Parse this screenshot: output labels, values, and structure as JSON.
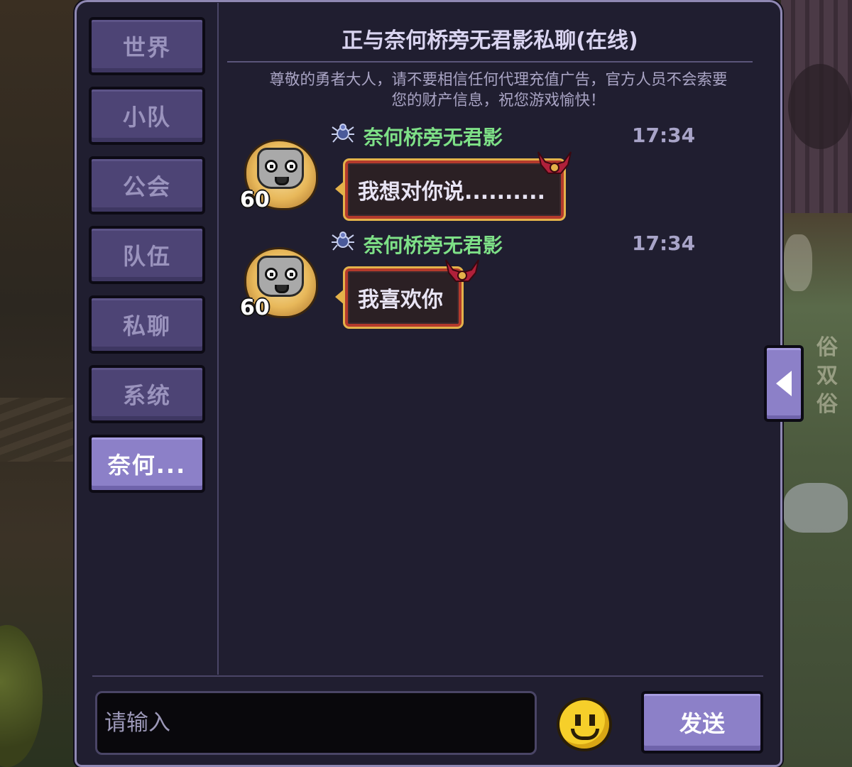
{
  "tabs": [
    {
      "label": "世界",
      "active": false
    },
    {
      "label": "小队",
      "active": false
    },
    {
      "label": "公会",
      "active": false
    },
    {
      "label": "队伍",
      "active": false
    },
    {
      "label": "私聊",
      "active": false
    },
    {
      "label": "系统",
      "active": false
    },
    {
      "label": "奈何...",
      "active": true
    }
  ],
  "header": {
    "title": "正与奈何桥旁无君影私聊(在线)",
    "notice_line1": "尊敬的勇者大人，请不要相信任何代理充值广告，官方人员不会索要",
    "notice_line2": "您的财产信息，祝您游戏愉快！"
  },
  "messages": [
    {
      "sender": "奈何桥旁无君影",
      "time": "17:34",
      "level": "60",
      "text": "我想对你说..........",
      "avatar_icon": "gray-creature-avatar-icon",
      "badge_icon": "spider-icon"
    },
    {
      "sender": "奈何桥旁无君影",
      "time": "17:34",
      "level": "60",
      "text": "我喜欢你",
      "avatar_icon": "gray-creature-avatar-icon",
      "badge_icon": "spider-icon"
    }
  ],
  "input": {
    "placeholder": "请输入",
    "value": ""
  },
  "send_label": "发送",
  "background_sign": "俗双俗",
  "icons": {
    "emoji": "smiley-icon",
    "side_arrow": "triangle-left-icon"
  },
  "colors": {
    "panel_bg": "#201e30",
    "tab_inactive": "#4d4475",
    "tab_active": "#8c80c8",
    "sender_green": "#7ee087",
    "bubble_border": "#b43a2c",
    "bubble_gold": "#e4b24a"
  }
}
